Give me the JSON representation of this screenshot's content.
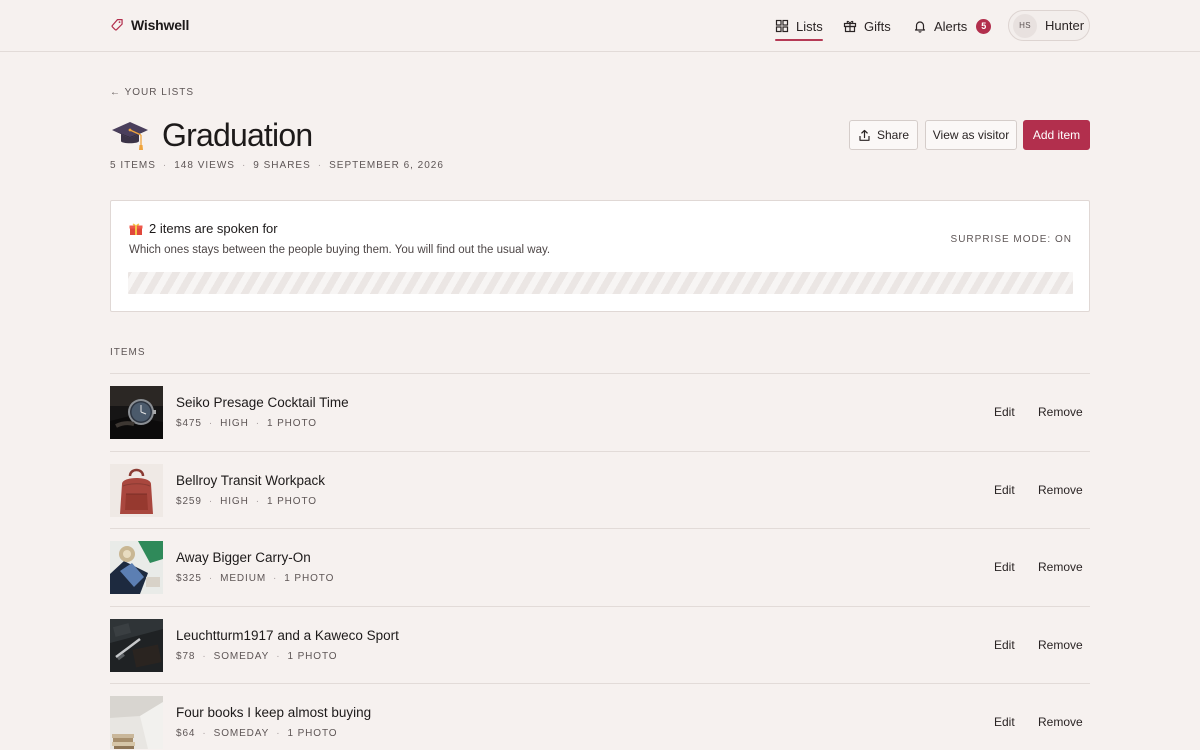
{
  "brand": {
    "name": "Wishwell"
  },
  "nav": {
    "lists": "Lists",
    "gifts": "Gifts",
    "alerts": "Alerts",
    "alerts_count": "5"
  },
  "user": {
    "initials": "HS",
    "name": "Hunter"
  },
  "back_link": "← YOUR LISTS",
  "list": {
    "emoji": "🎓",
    "title": "Graduation",
    "meta": [
      "5 ITEMS",
      "148 VIEWS",
      "9 SHARES",
      "SEPTEMBER 6, 2026"
    ]
  },
  "actions": {
    "share": "Share",
    "view_as_visitor": "View as visitor",
    "add_item": "Add item"
  },
  "surprise_panel": {
    "emoji": "🎁",
    "heading": "2 items are spoken for",
    "subtext": "Which ones stays between the people buying them. You will find out the usual way.",
    "mode": "SURPRISE MODE: ON"
  },
  "items_section": {
    "label": "ITEMS",
    "edit_label": "Edit",
    "remove_label": "Remove",
    "items": [
      {
        "title": "Seiko Presage Cocktail Time",
        "price": "$475",
        "priority": "HIGH",
        "photos": "1 PHOTO",
        "thumb": "watch"
      },
      {
        "title": "Bellroy Transit Workpack",
        "price": "$259",
        "priority": "HIGH",
        "photos": "1 PHOTO",
        "thumb": "backpack"
      },
      {
        "title": "Away Bigger Carry-On",
        "price": "$325",
        "priority": "MEDIUM",
        "photos": "1 PHOTO",
        "thumb": "luggage"
      },
      {
        "title": "Leuchtturm1917 and a Kaweco Sport",
        "price": "$78",
        "priority": "SOMEDAY",
        "photos": "1 PHOTO",
        "thumb": "notebook"
      },
      {
        "title": "Four books I keep almost buying",
        "price": "$64",
        "priority": "SOMEDAY",
        "photos": "1 PHOTO",
        "thumb": "books"
      }
    ]
  },
  "colors": {
    "accent": "#b22f4d",
    "background": "#f6f1ef"
  }
}
